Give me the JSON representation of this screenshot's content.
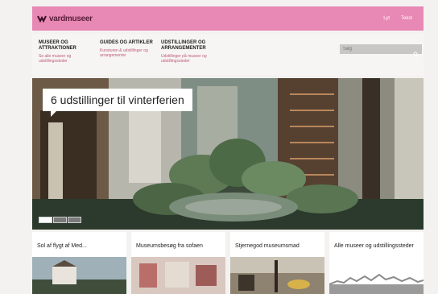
{
  "header": {
    "logo_text": "vardmuseer",
    "links": [
      "Lyt",
      "Tekst"
    ]
  },
  "nav": {
    "items": [
      {
        "title": "MUSEER OG ATTRAKTIONER",
        "sub": "Se alle museer og udstillingssteder"
      },
      {
        "title": "GUIDES OG ARTIKLER",
        "sub": "Kunsturen & udstillinger og arrangementer"
      },
      {
        "title": "UDSTILLINGER OG ARRANGEMENTER",
        "sub": "Udstillinger på museer og udstillingssteder"
      }
    ],
    "search_placeholder": "Søg"
  },
  "hero": {
    "callout": "6 udstillinger til vinterferien",
    "slides_total": 3,
    "slide_active": 1
  },
  "cards": [
    {
      "title": "Sol af flygt af Med..."
    },
    {
      "title": "Museumsbesøg fra sofaen"
    },
    {
      "title": "Stjernegod museumsmad"
    },
    {
      "title": "Alle museer og udstillingssteder"
    }
  ],
  "colors": {
    "brand_pink": "#e888b4",
    "accent": "#c05a7f"
  },
  "icons": [
    "logo-icon",
    "search-icon"
  ]
}
